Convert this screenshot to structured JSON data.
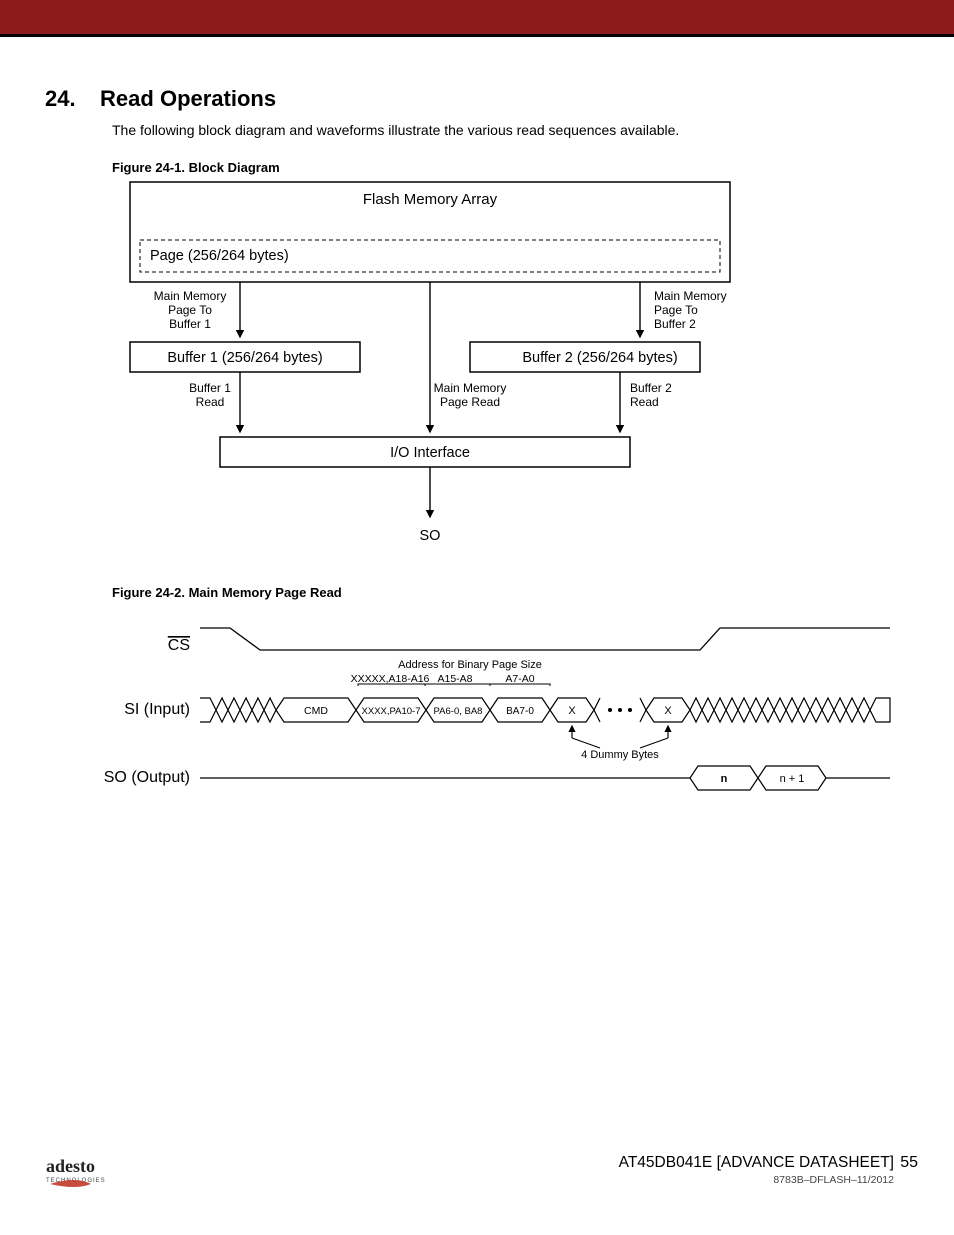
{
  "header": {
    "section_number": "24.",
    "section_title": "Read Operations",
    "intro": "The following block diagram and waveforms illustrate the various read sequences available."
  },
  "figure1": {
    "caption_num": "Figure 24-1.",
    "caption_title": "Block Diagram",
    "flash_memory_array": "Flash Memory Array",
    "page_label": "Page (256/264 bytes)",
    "mm_to_buf1_l1": "Main Memory",
    "mm_to_buf1_l2": "Page To",
    "mm_to_buf1_l3": "Buffer 1",
    "mm_to_buf2_l1": "Main Memory",
    "mm_to_buf2_l2": "Page To",
    "mm_to_buf2_l3": "Buffer 2",
    "buffer1": "Buffer 1 (256/264 bytes)",
    "buffer2": "Buffer 2 (256/264 bytes)",
    "buf1_read_l1": "Buffer 1",
    "buf1_read_l2": "Read",
    "mm_page_read_l1": "Main Memory",
    "mm_page_read_l2": "Page Read",
    "buf2_read_l1": "Buffer 2",
    "buf2_read_l2": "Read",
    "io_interface": "I/O Interface",
    "so": "SO"
  },
  "figure2": {
    "caption_num": "Figure 24-2.",
    "caption_title": "Main Memory Page Read",
    "cs": "CS",
    "si": "SI (Input)",
    "so": "SO (Output)",
    "addr_header": "Address for Binary Page Size",
    "addr_seg1": "XXXXX,A18-A16",
    "addr_seg2": "A15-A8",
    "addr_seg3": "A7-A0",
    "cmd": "CMD",
    "cell1": "XXXX,PA10-7",
    "cell2": "PA6-0, BA8",
    "cell3": "BA7-0",
    "x": "X",
    "dummy_note": "4 Dummy Bytes",
    "out_n": "n",
    "out_np1": "n + 1"
  },
  "footer": {
    "brand_main": "adesto",
    "brand_sub": "TECHNOLOGIES",
    "part": "AT45DB041E [ADVANCE DATASHEET]",
    "page": "55",
    "docid": "8783B–DFLASH–11/2012"
  }
}
